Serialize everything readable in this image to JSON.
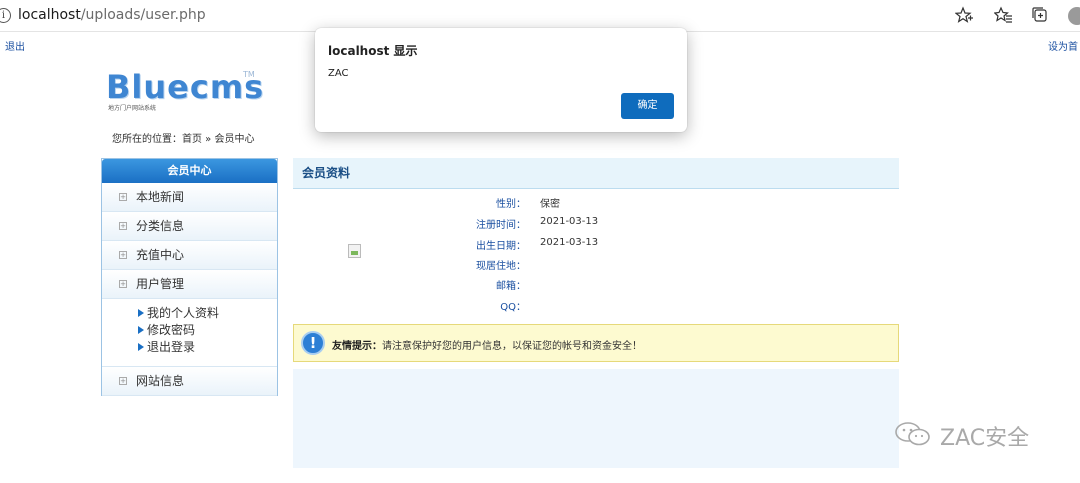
{
  "browser": {
    "url_host": "localhost",
    "url_path": "/uploads/user.php",
    "info_glyph": "i",
    "icons": [
      "star-add-icon",
      "favorites-icon",
      "collections-icon",
      "profile-icon"
    ]
  },
  "site": {
    "top_left_link": "退出",
    "top_right_link": "设为首",
    "logo_text": "Bluecms",
    "logo_tm": "TM",
    "logo_subtitle": "地方门户网站系统",
    "breadcrumb": "您所在的位置：首页 » 会员中心"
  },
  "sidebar": {
    "title": "会员中心",
    "items": [
      {
        "label": "本地新闻"
      },
      {
        "label": "分类信息"
      },
      {
        "label": "充值中心"
      },
      {
        "label": "用户管理"
      }
    ],
    "sub_items": [
      {
        "label": "我的个人资料"
      },
      {
        "label": "修改密码"
      },
      {
        "label": "退出登录"
      }
    ],
    "last_item": {
      "label": "网站信息"
    }
  },
  "profile": {
    "header": "会员资料",
    "fields": [
      {
        "label": "性别：",
        "value": "保密"
      },
      {
        "label": "注册时间：",
        "value": "2021-03-13"
      },
      {
        "label": "出生日期：",
        "value": "2021-03-13"
      },
      {
        "label": "现居住地：",
        "value": ""
      },
      {
        "label": "邮箱：",
        "value": ""
      },
      {
        "label": "QQ：",
        "value": ""
      }
    ]
  },
  "notice": {
    "icon_glyph": "!",
    "bold": "友情提示：",
    "text": "请注意保护好您的用户信息，以保证您的帐号和资金安全！"
  },
  "dialog": {
    "title": "localhost 显示",
    "message": "ZAC",
    "ok_label": "确定"
  },
  "watermark": {
    "text": "ZAC安全"
  },
  "colors": {
    "accent": "#0f6cbd",
    "sidebar_title": "#1a6fc4",
    "link": "#1a4fa0",
    "notice_bg": "#fdfad0"
  }
}
